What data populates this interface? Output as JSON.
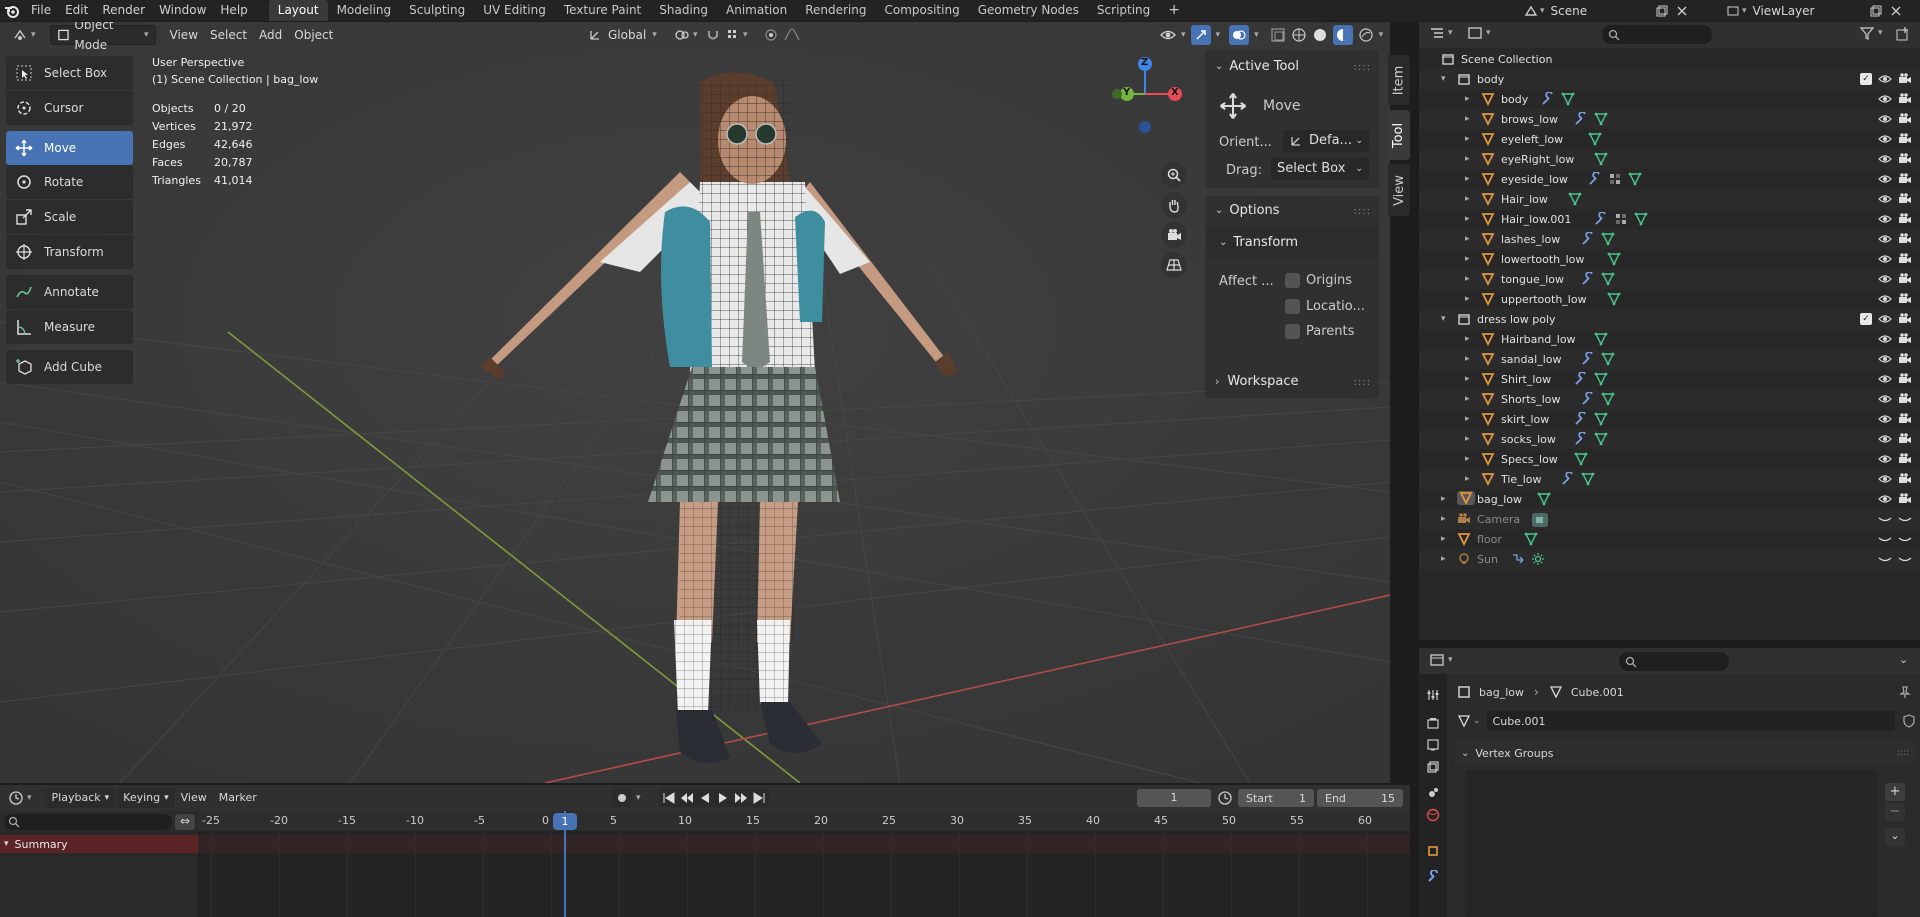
{
  "topbar": {
    "menus": [
      "File",
      "Edit",
      "Render",
      "Window",
      "Help"
    ],
    "workspaces": [
      "Layout",
      "Modeling",
      "Sculpting",
      "UV Editing",
      "Texture Paint",
      "Shading",
      "Animation",
      "Rendering",
      "Compositing",
      "Geometry Nodes",
      "Scripting"
    ],
    "active_workspace": "Layout",
    "add_tab": "+",
    "scene_label": "Scene",
    "view_layer_label": "ViewLayer"
  },
  "viewport": {
    "mode": "Object Mode",
    "menus": [
      "View",
      "Select",
      "Add",
      "Object"
    ],
    "orientation": "Global",
    "perspective": "User Perspective",
    "collection_path": "(1) Scene Collection | bag_low",
    "stats": [
      {
        "label": "Objects",
        "value": "0 / 20"
      },
      {
        "label": "Vertices",
        "value": "21,972"
      },
      {
        "label": "Edges",
        "value": "42,646"
      },
      {
        "label": "Faces",
        "value": "20,787"
      },
      {
        "label": "Triangles",
        "value": "41,014"
      }
    ],
    "tools": [
      {
        "label": "Select Box",
        "icon": "select-box-icon"
      },
      {
        "label": "Cursor",
        "icon": "cursor-icon"
      },
      {
        "label": "Move",
        "icon": "move-icon",
        "active": true
      },
      {
        "label": "Rotate",
        "icon": "rotate-icon"
      },
      {
        "label": "Scale",
        "icon": "scale-icon"
      },
      {
        "label": "Transform",
        "icon": "transform-icon"
      },
      {
        "label": "Annotate",
        "icon": "annotate-icon"
      },
      {
        "label": "Measure",
        "icon": "measure-icon"
      },
      {
        "label": "Add Cube",
        "icon": "add-cube-icon"
      }
    ],
    "gizmo_axes": {
      "z": "Z",
      "y": "Y",
      "x": "X"
    }
  },
  "npanel": {
    "active_tool_title": "Active Tool",
    "tool_name": "Move",
    "orient_label": "Orient...",
    "orient_value": "Defa...",
    "drag_label": "Drag:",
    "drag_value": "Select Box",
    "options_title": "Options",
    "transform_title": "Transform",
    "affect_label": "Affect ...",
    "affect_options": [
      "Origins",
      "Locatio...",
      "Parents"
    ],
    "workspace_title": "Workspace",
    "tabs": [
      "Item",
      "Tool",
      "View"
    ]
  },
  "outliner": {
    "root": "Scene Collection",
    "rows": [
      {
        "name": "body",
        "type": "collection",
        "level": 1,
        "checkbox": true
      },
      {
        "name": "body",
        "type": "mesh",
        "level": 2,
        "mods": [
          "wrench",
          "mesh"
        ]
      },
      {
        "name": "brows_low",
        "type": "mesh",
        "level": 2,
        "mods": [
          "wrench",
          "mesh"
        ]
      },
      {
        "name": "eyeleft_low",
        "type": "mesh",
        "level": 2,
        "mods": [
          "mesh"
        ]
      },
      {
        "name": "eyeRight_low",
        "type": "mesh",
        "level": 2,
        "mods": [
          "mesh"
        ]
      },
      {
        "name": "eyeside_low",
        "type": "mesh",
        "level": 2,
        "mods": [
          "wrench",
          "checker",
          "mesh"
        ]
      },
      {
        "name": "Hair_low",
        "type": "mesh",
        "level": 2,
        "mods": [
          "mesh"
        ]
      },
      {
        "name": "Hair_low.001",
        "type": "mesh",
        "level": 2,
        "mods": [
          "wrench",
          "checker",
          "mesh"
        ]
      },
      {
        "name": "lashes_low",
        "type": "mesh",
        "level": 2,
        "mods": [
          "wrench",
          "mesh"
        ]
      },
      {
        "name": "lowertooth_low",
        "type": "mesh",
        "level": 2,
        "mods": [
          "mesh"
        ]
      },
      {
        "name": "tongue_low",
        "type": "mesh",
        "level": 2,
        "mods": [
          "wrench",
          "mesh"
        ]
      },
      {
        "name": "uppertooth_low",
        "type": "mesh",
        "level": 2,
        "mods": [
          "mesh"
        ]
      },
      {
        "name": "dress low poly",
        "type": "collection",
        "level": 1,
        "checkbox": true
      },
      {
        "name": "Hairband_low",
        "type": "mesh",
        "level": 2,
        "mods": [
          "mesh"
        ]
      },
      {
        "name": "sandal_low",
        "type": "mesh",
        "level": 2,
        "mods": [
          "wrench",
          "mesh"
        ]
      },
      {
        "name": "Shirt_low",
        "type": "mesh",
        "level": 2,
        "mods": [
          "wrench",
          "mesh"
        ]
      },
      {
        "name": "Shorts_low",
        "type": "mesh",
        "level": 2,
        "mods": [
          "wrench",
          "mesh"
        ]
      },
      {
        "name": "skirt_low",
        "type": "mesh",
        "level": 2,
        "mods": [
          "wrench",
          "mesh"
        ]
      },
      {
        "name": "socks_low",
        "type": "mesh",
        "level": 2,
        "mods": [
          "wrench",
          "mesh"
        ]
      },
      {
        "name": "Specs_low",
        "type": "mesh",
        "level": 2,
        "mods": [
          "mesh"
        ]
      },
      {
        "name": "Tie_low",
        "type": "mesh",
        "level": 2,
        "mods": [
          "wrench",
          "mesh"
        ]
      },
      {
        "name": "bag_low",
        "type": "mesh",
        "level": 1,
        "mods": [
          "mesh"
        ],
        "active": true
      },
      {
        "name": "Camera",
        "type": "camera",
        "level": 1,
        "mods": [
          "camdata"
        ],
        "hidden": true
      },
      {
        "name": "floor",
        "type": "mesh",
        "level": 1,
        "mods": [
          "mesh"
        ],
        "hidden": true
      },
      {
        "name": "Sun",
        "type": "light",
        "level": 1,
        "mods": [
          "constraint",
          "sun"
        ],
        "hidden": true
      }
    ]
  },
  "properties": {
    "breadcrumb_object": "bag_low",
    "breadcrumb_data": "Cube.001",
    "data_name": "Cube.001",
    "section": "Vertex Groups"
  },
  "timeline": {
    "menus": [
      "Playback",
      "Keying",
      "View",
      "Marker"
    ],
    "current_frame": "1",
    "start_label": "Start",
    "start_value": "1",
    "end_label": "End",
    "end_value": "15",
    "ruler_ticks": [
      "-25",
      "-20",
      "-15",
      "-10",
      "-5",
      "0",
      "5",
      "10",
      "15",
      "20",
      "25",
      "30",
      "35",
      "40",
      "45",
      "50",
      "55",
      "60"
    ],
    "summary_label": "Summary"
  },
  "colors": {
    "accent": "#4772b3",
    "mesh_orange": "#e0963d",
    "mesh_green": "#49c489",
    "modifier_blue": "#7aa1e6",
    "x_axis": "#e84b56",
    "y_axis": "#75b543",
    "z_axis": "#3f86e6"
  }
}
